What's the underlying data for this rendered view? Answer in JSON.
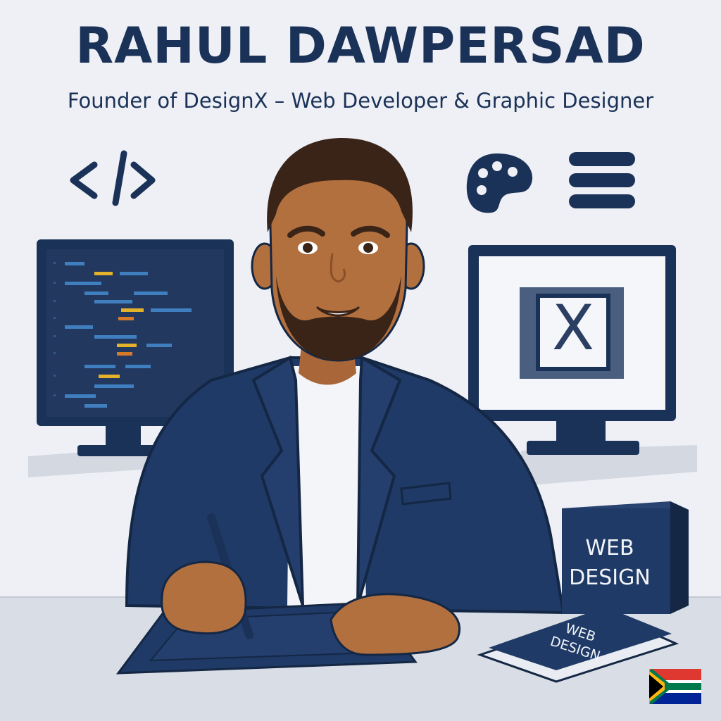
{
  "header": {
    "name": "RAHUL DAWPERSAD",
    "tagline": "Founder of DesignX – Web Developer & Graphic Designer"
  },
  "logo_screen": {
    "letter": "X"
  },
  "box": {
    "line1": "WEB",
    "line2": "DESIGN"
  },
  "book": {
    "line1": "WEB",
    "line2": "DESIGN"
  },
  "icons": [
    "code-icon",
    "palette-icon",
    "menu-icon",
    "south-africa-flag-icon"
  ],
  "colors": {
    "navy": "#1b3258",
    "background": "#eef0f5",
    "skin": "#b3703f",
    "accent_yellow": "#e3b22a",
    "accent_blue": "#3f7fc0"
  }
}
